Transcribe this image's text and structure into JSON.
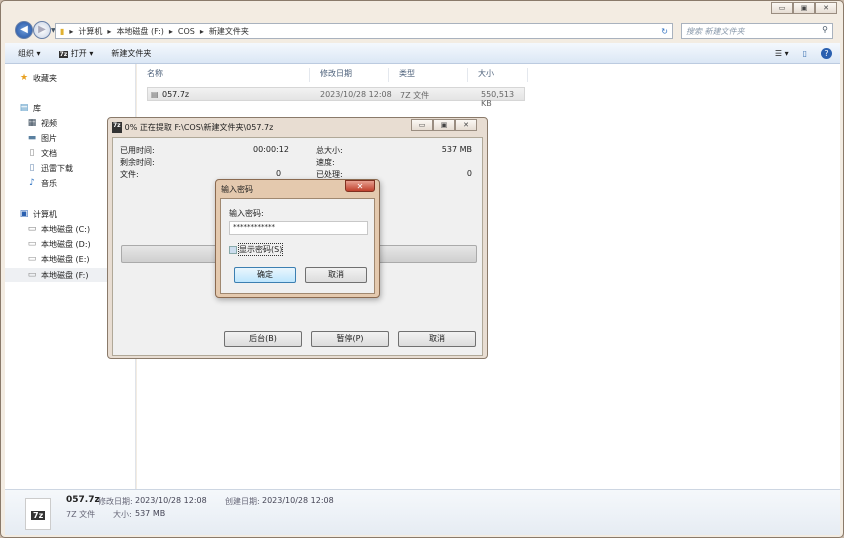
{
  "window": {
    "controls": [
      "▭",
      "▣",
      "✕"
    ]
  },
  "address": {
    "crumbs": [
      "计算机",
      "本地磁盘 (F:)",
      "COS",
      "新建文件夹"
    ],
    "search_placeholder": "搜索 新建文件夹"
  },
  "toolbar": {
    "organize": "组织 ▾",
    "open": "打开 ▾",
    "new_folder": "新建文件夹"
  },
  "sidebar": {
    "favorites": "收藏夹",
    "library": "库",
    "lib_items": [
      "视频",
      "图片",
      "文档",
      "迅雷下载",
      "音乐"
    ],
    "computer": "计算机",
    "drives": [
      "本地磁盘 (C:)",
      "本地磁盘 (D:)",
      "本地磁盘 (E:)",
      "本地磁盘 (F:)"
    ]
  },
  "columns": {
    "name": "名称",
    "date": "修改日期",
    "type": "类型",
    "size": "大小"
  },
  "files": [
    {
      "name": "057.7z",
      "date": "2023/10/28 12:08",
      "type": "7Z 文件",
      "size": "550,513 KB"
    }
  ],
  "details": {
    "name": "057.7z",
    "modified_label": "修改日期:",
    "modified": "2023/10/28 12:08",
    "created_label": "创建日期:",
    "created": "2023/10/28 12:08",
    "type": "7Z 文件",
    "size_label": "大小:",
    "size": "537 MB",
    "icon_text": "7z"
  },
  "extract": {
    "title": "0% 正在提取 F:\\COS\\新建文件夹\\057.7z",
    "elapsed_label": "已用时间:",
    "elapsed": "00:00:12",
    "remaining_label": "剩余时间:",
    "files_label": "文件:",
    "files": "0",
    "total_label": "总大小:",
    "total": "537 MB",
    "speed_label": "速度:",
    "processed_label": "已处理:",
    "processed": "0",
    "progress": 0,
    "background": "后台(B)",
    "pause": "暂停(P)",
    "cancel": "取消"
  },
  "password": {
    "title": "输入密码",
    "label": "输入密码:",
    "value": "************",
    "show_label": "显示密码(S)",
    "show_checked": false,
    "ok": "确定",
    "cancel": "取消"
  }
}
